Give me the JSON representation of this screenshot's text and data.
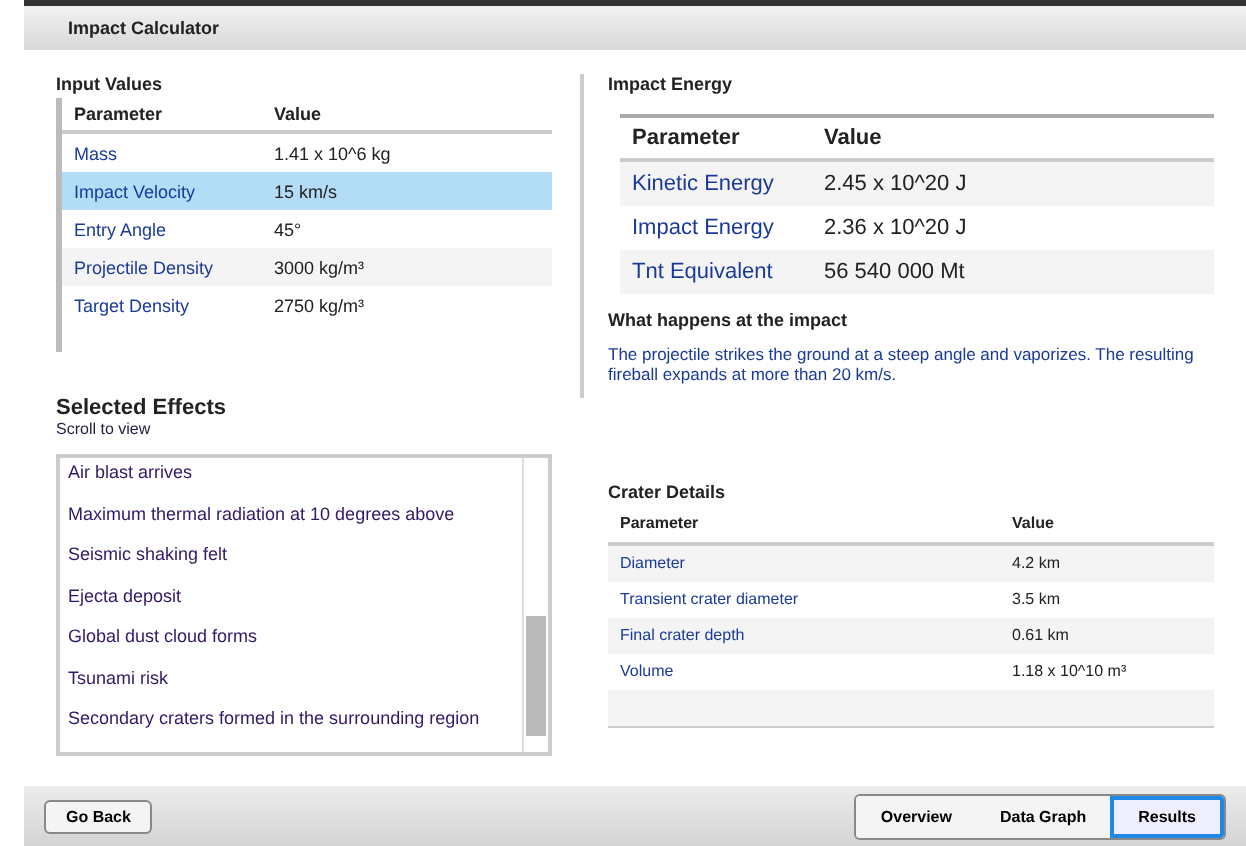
{
  "window": {
    "title": "Impact Calculator"
  },
  "input_values": {
    "title": "Input Values",
    "columns": [
      "Parameter",
      "Value"
    ],
    "rows": [
      {
        "parameter": "Mass",
        "value": "1.41 x 10^6 kg",
        "selected": false
      },
      {
        "parameter": "Impact Velocity",
        "value": "15 km/s",
        "selected": true
      },
      {
        "parameter": "Entry Angle",
        "value": "45°",
        "selected": false
      },
      {
        "parameter": "Projectile Density",
        "value": "3000 kg/m³",
        "selected": false
      },
      {
        "parameter": "Target Density",
        "value": "2750 kg/m³",
        "selected": false
      }
    ]
  },
  "impact_energy": {
    "title": "Impact Energy",
    "columns": [
      "Parameter",
      "Value"
    ],
    "rows": [
      {
        "parameter": "Kinetic Energy",
        "value": "2.45 x 10^20 J"
      },
      {
        "parameter": "Impact Energy",
        "value": "2.36 x 10^20 J"
      },
      {
        "parameter": "Tnt Equivalent",
        "value": "56 540 000 Mt"
      }
    ]
  },
  "what_happens": {
    "title": "What happens at the impact",
    "text": "The projectile strikes the ground at a steep angle and vaporizes. The resulting fireball expands at more than 20 km/s."
  },
  "effects": {
    "title": "Selected Effects",
    "subtitle": "Scroll to view",
    "items": [
      "Air blast arrives",
      "Maximum thermal radiation at 10 degrees above",
      "Seismic shaking felt",
      "Ejecta deposit",
      "Global dust cloud forms",
      "Tsunami risk",
      "Secondary craters formed in the surrounding region"
    ]
  },
  "crater": {
    "title": "Crater Details",
    "columns": [
      "Parameter",
      "Value"
    ],
    "rows": [
      {
        "parameter": "Diameter",
        "value": "4.2 km"
      },
      {
        "parameter": "Transient crater diameter",
        "value": "3.5 km"
      },
      {
        "parameter": "Final crater depth",
        "value": "0.61 km"
      },
      {
        "parameter": "Volume",
        "value": "1.18 x 10^10 m³"
      }
    ]
  },
  "buttons": {
    "back": "Go Back",
    "segments": [
      {
        "label": "Overview",
        "selected": false
      },
      {
        "label": "Data Graph",
        "selected": false
      },
      {
        "label": "Results",
        "selected": true
      }
    ]
  }
}
